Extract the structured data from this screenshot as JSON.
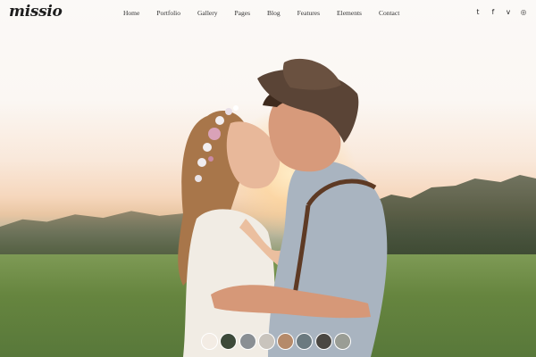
{
  "brand": {
    "logo": "missio"
  },
  "nav": {
    "items": [
      {
        "label": "Home"
      },
      {
        "label": "Portfolio"
      },
      {
        "label": "Gallery"
      },
      {
        "label": "Pages"
      },
      {
        "label": "Blog"
      },
      {
        "label": "Features"
      },
      {
        "label": "Elements"
      },
      {
        "label": "Contact"
      }
    ]
  },
  "social": {
    "icons": [
      {
        "name": "twitter-icon",
        "glyph": "t"
      },
      {
        "name": "facebook-icon",
        "glyph": "f"
      },
      {
        "name": "vimeo-icon",
        "glyph": "v"
      },
      {
        "name": "instagram-icon",
        "glyph": "◎"
      }
    ]
  },
  "slider": {
    "thumbnails": [
      {
        "color": "#f3ece4"
      },
      {
        "color": "#3d4a3a"
      },
      {
        "color": "#8a8f94"
      },
      {
        "color": "#c9c4bd"
      },
      {
        "color": "#b58a6a"
      },
      {
        "color": "#6b7a80"
      },
      {
        "color": "#4a4742"
      },
      {
        "color": "#9a9d95"
      }
    ]
  },
  "colors": {
    "text": "#333333",
    "accent": "#1d1d1d"
  }
}
